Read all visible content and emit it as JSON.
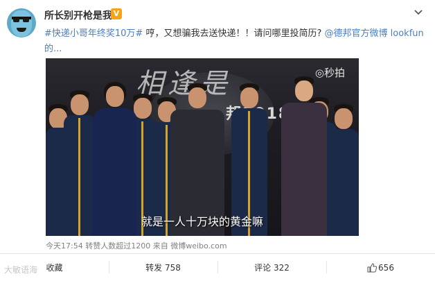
{
  "header": {
    "username": "所长别开枪是我",
    "verified_badge": "V",
    "more_icon": "chevron-down-icon"
  },
  "post": {
    "hashtag": "#快递小哥年终奖10万#",
    "text_1": " 哼，又想骗我去送快递！！请问哪里投简历? ",
    "mention": "@德邦官方微博",
    "text_2": " lookfun",
    "text_3": "的..."
  },
  "media": {
    "banner_text": "相逢是",
    "banner_year": "邦2018年会",
    "watermark": "◎秒拍",
    "subtitle": "就是一人十万块的黄金嘛"
  },
  "meta": {
    "time": "今天17:54",
    "reposts": "转赞人数超过1200",
    "source": "来自 微博weibo.com"
  },
  "actions": {
    "collect": "收藏",
    "repost": "转发 758",
    "comment": "评论 322",
    "like": "656"
  },
  "site_mark": "大敏语海",
  "colors": {
    "link": "#4a7fbf",
    "badge": "#f7a21b"
  }
}
